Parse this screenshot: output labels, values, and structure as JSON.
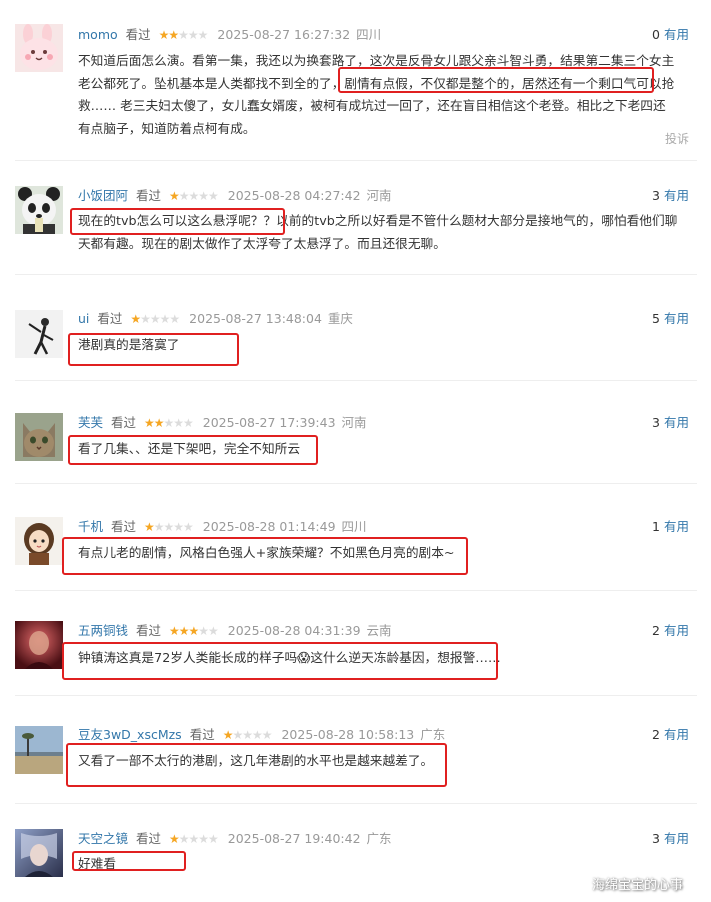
{
  "watched_label": "看过",
  "useful_label": "有用",
  "report_label": "投诉",
  "watermark": "海绵宝宝的心事",
  "colors": {
    "username": "#3377aa",
    "star": "#f5a623",
    "highlight_box": "#e02020"
  },
  "comments": [
    {
      "user": "momo",
      "rating": 2,
      "time": "2025-08-27 16:27:32",
      "location": "四川",
      "useful": "0",
      "avatar": "pink-bunny-avatar",
      "text_lines": [
        "不知道后面怎么演。看第一集，我还以为换套路了，这次是反骨女儿跟父亲斗智斗勇，结果第二集三个女主",
        "老公都死了。坠机基本是人类都找不到全的了，剧情有点假，不仅都是整个的，居然还有一个剩口气可以抢",
        "救…… 老三夫妇太傻了，女儿蠢女婿废，被柯有成坑过一回了，还在盲目相信这个老登。相比之下老四还",
        "有点脑子，知道防着点柯有成。"
      ]
    },
    {
      "user": "小饭团阿",
      "rating": 1,
      "time": "2025-08-28 04:27:42",
      "location": "河南",
      "useful": "3",
      "avatar": "panda-avatar",
      "text_lines": [
        "现在的tvb怎么可以这么悬浮呢？？以前的tvb之所以好看是不管什么题材大部分是接地气的，哪怕看他们聊",
        "天都有趣。现在的剧太做作了太浮夸了太悬浮了。而且还很无聊。"
      ]
    },
    {
      "user": "ui",
      "rating": 1,
      "time": "2025-08-27 13:48:04",
      "location": "重庆",
      "useful": "5",
      "avatar": "dancer-avatar",
      "text_lines": [
        "港剧真的是落寞了"
      ]
    },
    {
      "user": "芙芙",
      "rating": 2,
      "time": "2025-08-27 17:39:43",
      "location": "河南",
      "useful": "3",
      "avatar": "cat-avatar",
      "text_lines": [
        "看了几集、、还是下架吧，完全不知所云"
      ]
    },
    {
      "user": "千机",
      "rating": 1,
      "time": "2025-08-28 01:14:49",
      "location": "四川",
      "useful": "1",
      "avatar": "girl-cartoon-avatar",
      "text_lines": [
        "有点儿老的剧情，风格白色强人+家族荣耀？不如黑色月亮的剧本~"
      ]
    },
    {
      "user": "五两铜钱",
      "rating": 3,
      "time": "2025-08-28 04:31:39",
      "location": "云南",
      "useful": "2",
      "avatar": "red-portrait-avatar",
      "text_lines": [
        "钟镇涛这真是72岁人类能长成的样子吗😱这什么逆天冻龄基因，想报警……"
      ]
    },
    {
      "user": "豆友3wD_xscMzs",
      "rating": 1,
      "time": "2025-08-28 10:58:13",
      "location": "广东",
      "useful": "2",
      "avatar": "landscape-avatar",
      "text_lines": [
        "又看了一部不太行的港剧，这几年港剧的水平也是越来越差了。"
      ]
    },
    {
      "user": "天空之镜",
      "rating": 1,
      "time": "2025-08-27 19:40:42",
      "location": "广东",
      "useful": "3",
      "avatar": "anime-portrait-avatar",
      "text_lines": [
        "好难看"
      ]
    }
  ]
}
